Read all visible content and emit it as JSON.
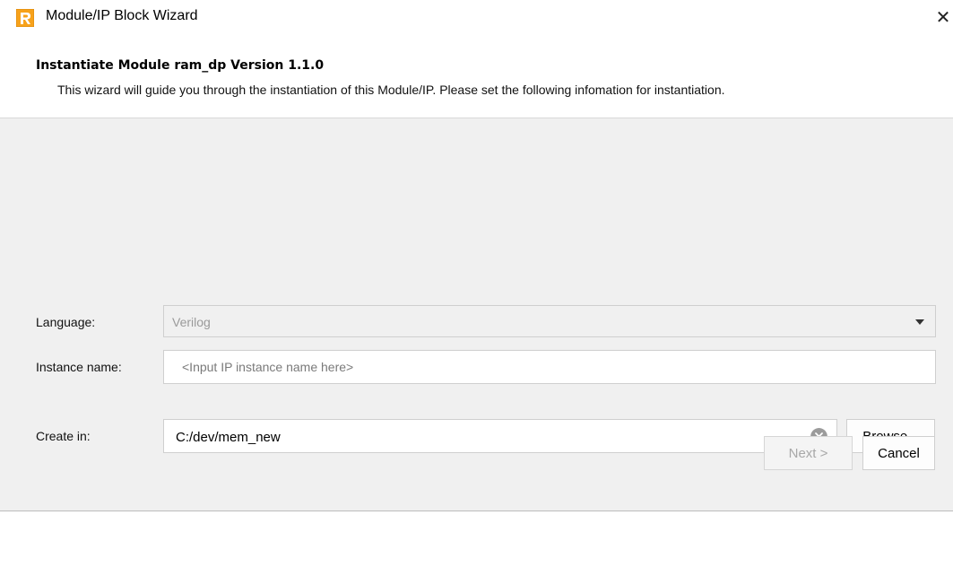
{
  "window": {
    "title": "Module/IP Block Wizard",
    "close_glyph": "✕",
    "app_icon": "radiant-logo-icon"
  },
  "header": {
    "title": "Instantiate Module ram_dp Version 1.1.0",
    "description": "This wizard will guide you through the instantiation of this Module/IP. Please set the following infomation for instantiation."
  },
  "form": {
    "language": {
      "label": "Language:",
      "value": "Verilog"
    },
    "instance_name": {
      "label": "Instance name:",
      "value": "",
      "placeholder": "<Input IP instance name here>"
    },
    "create_in": {
      "label": "Create in:",
      "value": "C:/dev/mem_new",
      "browse_label": "Browse..."
    }
  },
  "footer": {
    "next_label": "Next >",
    "next_enabled": false,
    "cancel_label": "Cancel"
  },
  "colors": {
    "app_icon_orange": "#f7a21b",
    "panel_background": "#f0f0f0",
    "disabled_text": "#a8a8a8"
  }
}
